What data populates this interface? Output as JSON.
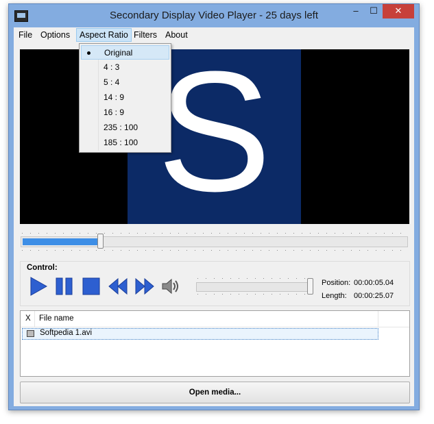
{
  "window": {
    "title": "Secondary Display Video Player - 25 days left",
    "controls": {
      "minimize": "–",
      "maximize": "☐",
      "close": "✕"
    }
  },
  "menu": {
    "items": [
      "File",
      "Options",
      "Aspect Ratio",
      "Filters",
      "About"
    ],
    "active": "Aspect Ratio"
  },
  "aspect_ratio_menu": {
    "items": [
      "Original",
      "4 : 3",
      "5 : 4",
      "14 : 9",
      "16 : 9",
      "235 : 100",
      "185 : 100"
    ],
    "selected": "Original"
  },
  "video": {
    "frame_letter": "S",
    "frame_color": "#0c2a66"
  },
  "seek": {
    "progress": 0.2
  },
  "controls": {
    "label": "Control:",
    "buttons": [
      "play-icon",
      "pause-icon",
      "stop-icon",
      "rewind-icon",
      "fast-forward-icon",
      "speaker-icon"
    ],
    "volume_level": 1.0,
    "position_label": "Position:",
    "position_value": "00:00:05.04",
    "length_label": "Length:",
    "length_value": "00:00:25.07",
    "accent_color": "#2d5fd0"
  },
  "file_list": {
    "columns": [
      "X",
      "File name"
    ],
    "rows": [
      {
        "name": "Softpedia 1.avi"
      }
    ]
  },
  "open_button": "Open media..."
}
